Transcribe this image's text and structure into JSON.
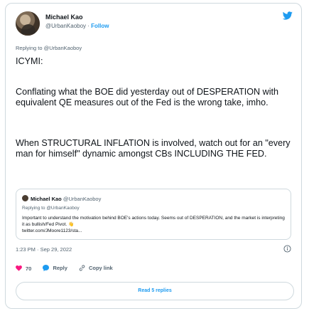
{
  "author": {
    "name": "Michael Kao",
    "handle": "@UrbanKaoboy",
    "separator": " · ",
    "follow_label": "Follow"
  },
  "replying_to": "Replying to @UrbanKaoboy",
  "tweet_paragraphs": [
    "ICYMI:",
    "Conflating what the BOE did yesterday out of DESPERATION with equivalent QE measures out of the Fed is the wrong take, imho.",
    "When STRUCTURAL INFLATION is involved, watch out for an \"every man for himself\" dynamic amongst CBs INCLUDING THE FED."
  ],
  "quoted_tweet": {
    "name": "Michael Kao",
    "handle": "@UrbanKaoboy",
    "replying_to": "Replying to @UrbanKaoboy",
    "text": "Important to understand the motivation behind BOE's actions today. Seems out of DESPERATION, and the market is interpreting it as bullish/Fed Pivot.",
    "emoji": "👋",
    "link": "twitter.com/JMoore1123/sta..."
  },
  "timestamp": "1:23 PM · Sep 29, 2022",
  "actions": {
    "likes": "70",
    "reply_label": "Reply",
    "copy_label": "Copy link"
  },
  "read_replies_label": "Read 5 replies",
  "colors": {
    "accent": "#1d9bf0",
    "like": "#f91880",
    "text": "#0f1419",
    "muted": "#536471",
    "border": "#cfd9de"
  },
  "icons": [
    "twitter-bird-icon",
    "info-icon",
    "heart-icon",
    "reply-bubble-icon",
    "copy-link-icon"
  ]
}
